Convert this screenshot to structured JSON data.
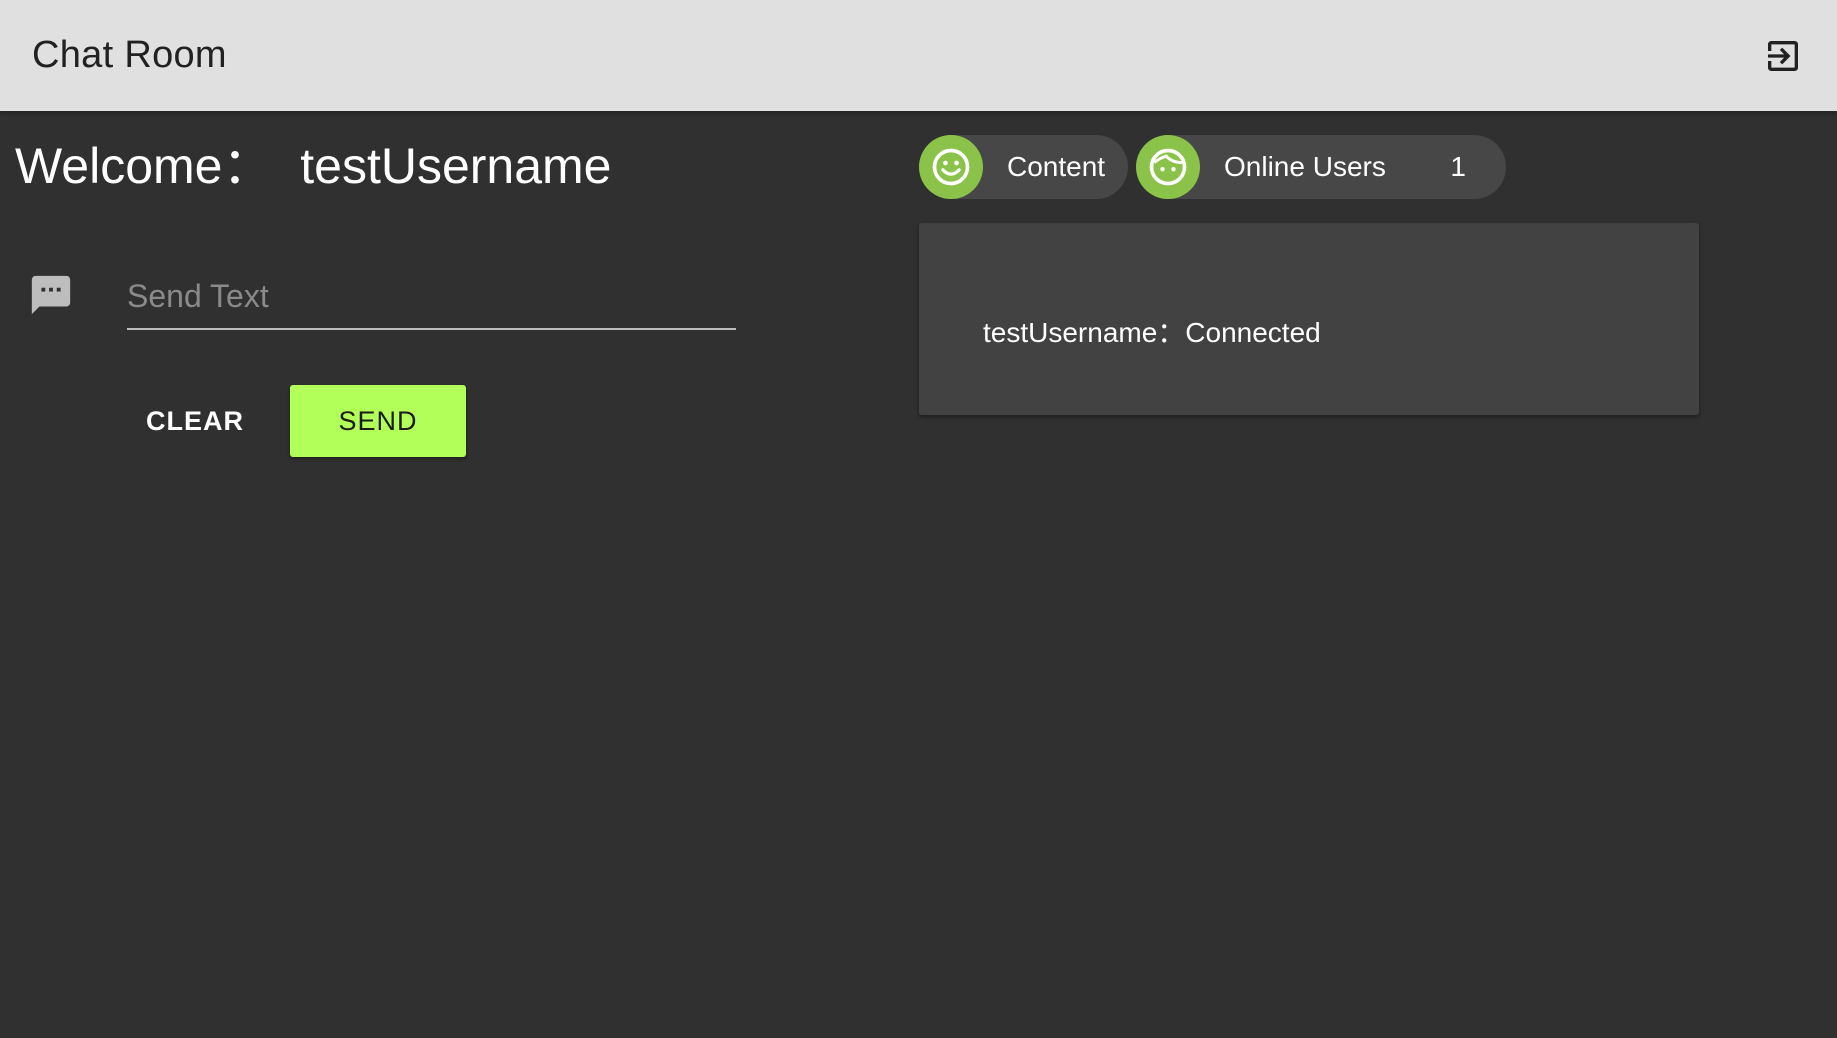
{
  "app_bar": {
    "title": "Chat Room",
    "logout_icon": "exit-to-app-icon"
  },
  "welcome": {
    "text": "Welcome：  testUsername"
  },
  "composer": {
    "icon": "message-icon",
    "placeholder": "Send Text",
    "value": "",
    "clear_label": "CLEAR",
    "send_label": "SEND"
  },
  "chips": {
    "content": {
      "icon": "smiley-face-icon",
      "label": "Content"
    },
    "online_users": {
      "icon": "face-icon",
      "label": "Online Users",
      "count": "1"
    }
  },
  "messages": [
    {
      "text": "testUsername：Connected"
    }
  ],
  "colors": {
    "app_bar_bg": "#e0e0e0",
    "page_bg": "#303030",
    "accent": "#b2ff59",
    "avatar_bg": "#8bc34a",
    "chip_bg": "#474747",
    "panel_bg": "#424242"
  }
}
